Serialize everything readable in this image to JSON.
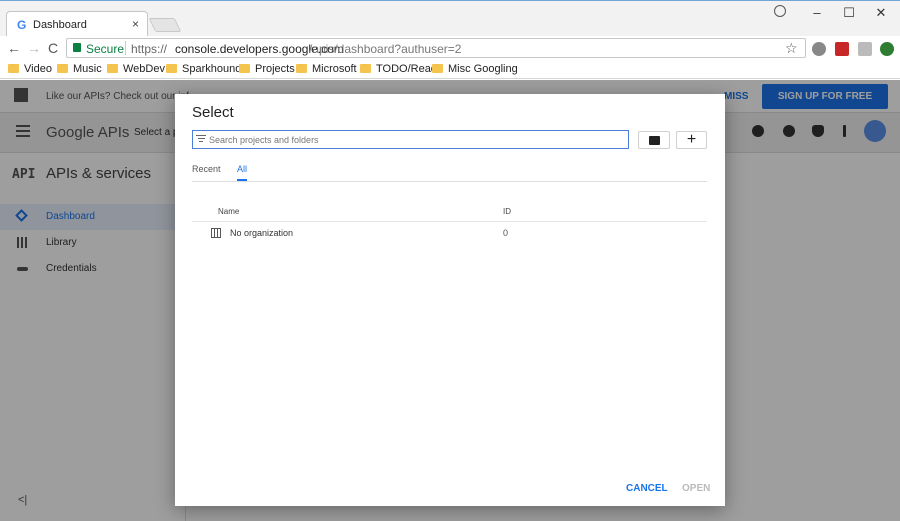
{
  "browser": {
    "tab_title": "Dashboard",
    "tab_favicon": "G",
    "tab_close": "×",
    "window_controls": {
      "minimize": "–",
      "maximize": "☐",
      "close": "✕"
    },
    "nav": {
      "back": "←",
      "forward": "→",
      "reload": "C"
    },
    "secure_label": "Secure",
    "url_scheme": "https://",
    "url_host": "console.developers.google.com",
    "url_path": "/apis/dashboard?authuser=2",
    "star": "☆",
    "bookmarks": [
      "Video",
      "Music",
      "WebDev",
      "Sparkhound",
      "Projects",
      "Microsoft",
      "TODO/Read",
      "Misc Googling"
    ]
  },
  "page": {
    "promo_text": "Like our APIs? Check out our inf",
    "dismiss_label": "MISS",
    "signup_label": "SIGN UP FOR FREE TRIAL",
    "logo_google": "Google",
    "logo_apis": " APIs",
    "select_project": "Select a p",
    "sidebar": {
      "badge": "API",
      "title": "APIs & services",
      "items": [
        {
          "label": "Dashboard",
          "icon": "dashboard-icon"
        },
        {
          "label": "Library",
          "icon": "library-icon"
        },
        {
          "label": "Credentials",
          "icon": "key-icon"
        }
      ],
      "collapse": "<|"
    }
  },
  "dialog": {
    "title": "Select",
    "search_placeholder": "Search projects and folders",
    "tabs": {
      "recent": "Recent",
      "all": "All"
    },
    "columns": {
      "name": "Name",
      "id": "ID"
    },
    "rows": [
      {
        "name": "No organization",
        "id": "0"
      }
    ],
    "cancel_label": "CANCEL",
    "open_label": "OPEN",
    "plus_label": "+"
  }
}
